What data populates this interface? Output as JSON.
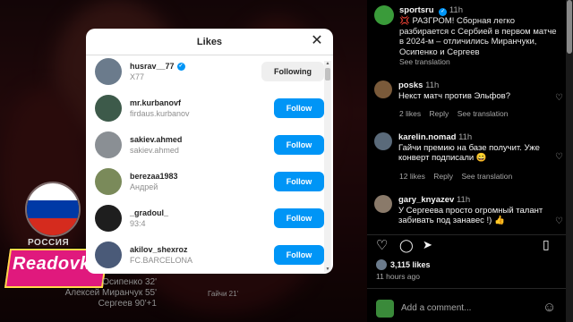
{
  "post": {
    "author": "sportsru",
    "author_time": "11h",
    "caption": "💢 РАЗГРОМ! Сборная легко разбирается с Сербией в первом матче в 2024-м – отличились Миранчуки, Осипенко и Сергеев",
    "see_translation": "See translation",
    "comments": [
      {
        "user": "posks",
        "time": "11h",
        "text": "Некст матч против Эльфов?",
        "likes": "2 likes",
        "reply": "Reply",
        "see_translation": "See translation"
      },
      {
        "user": "karelin.nomad",
        "time": "11h",
        "text": "Гайчи премию на базе получит. Уже конверт подписали 😄",
        "likes": "12 likes",
        "reply": "Reply",
        "see_translation": "See translation"
      },
      {
        "user": "gary_knyazev",
        "time": "11h",
        "text": "У Сергеева просто огромный талант забивать под занавес !) 👍",
        "likes": "",
        "reply": "",
        "see_translation": ""
      }
    ],
    "likes_count": "3,115 likes",
    "time_ago": "11 hours ago",
    "add_comment_placeholder": "Add a comment..."
  },
  "media": {
    "country": "РОССИЯ",
    "logo": "Readovka",
    "scorers": [
      "Осипенко 32'",
      "Алексей Миранчук 55'",
      "Сергеев 90'+1"
    ],
    "scorer_right": "Гайчи 21'",
    "flag_colors": [
      "#ffffff",
      "#0039a6",
      "#d52b1e"
    ]
  },
  "modal": {
    "title": "Likes",
    "users": [
      {
        "username": "husrav__77",
        "fullname": "X77",
        "verified": true,
        "button": "Following",
        "button_style": "following",
        "avatar_color": "#6b7b8c"
      },
      {
        "username": "mr.kurbanovf",
        "fullname": "firdaus.kurbanov",
        "verified": false,
        "button": "Follow",
        "button_style": "follow",
        "avatar_color": "#3d5a4a"
      },
      {
        "username": "sakiev.ahmed",
        "fullname": "sakiev.ahmed",
        "verified": false,
        "button": "Follow",
        "button_style": "follow",
        "avatar_color": "#8a8f94"
      },
      {
        "username": "berezaa1983",
        "fullname": "Андрей",
        "verified": false,
        "button": "Follow",
        "button_style": "follow",
        "avatar_color": "#7a8a5a"
      },
      {
        "username": "_gradoul_",
        "fullname": "93:4",
        "verified": false,
        "button": "Follow",
        "button_style": "follow",
        "avatar_color": "#1e1e1e"
      },
      {
        "username": "akilov_shexroz",
        "fullname": "FC.BARCELONA",
        "verified": false,
        "button": "Follow",
        "button_style": "follow",
        "avatar_color": "#4a5a78"
      }
    ]
  },
  "icons": {
    "verified": "✓",
    "close": "✕",
    "heart": "♡",
    "comment": "◯",
    "share": "➤",
    "bookmark": "▯",
    "emoji": "☺",
    "more": "⋯"
  }
}
